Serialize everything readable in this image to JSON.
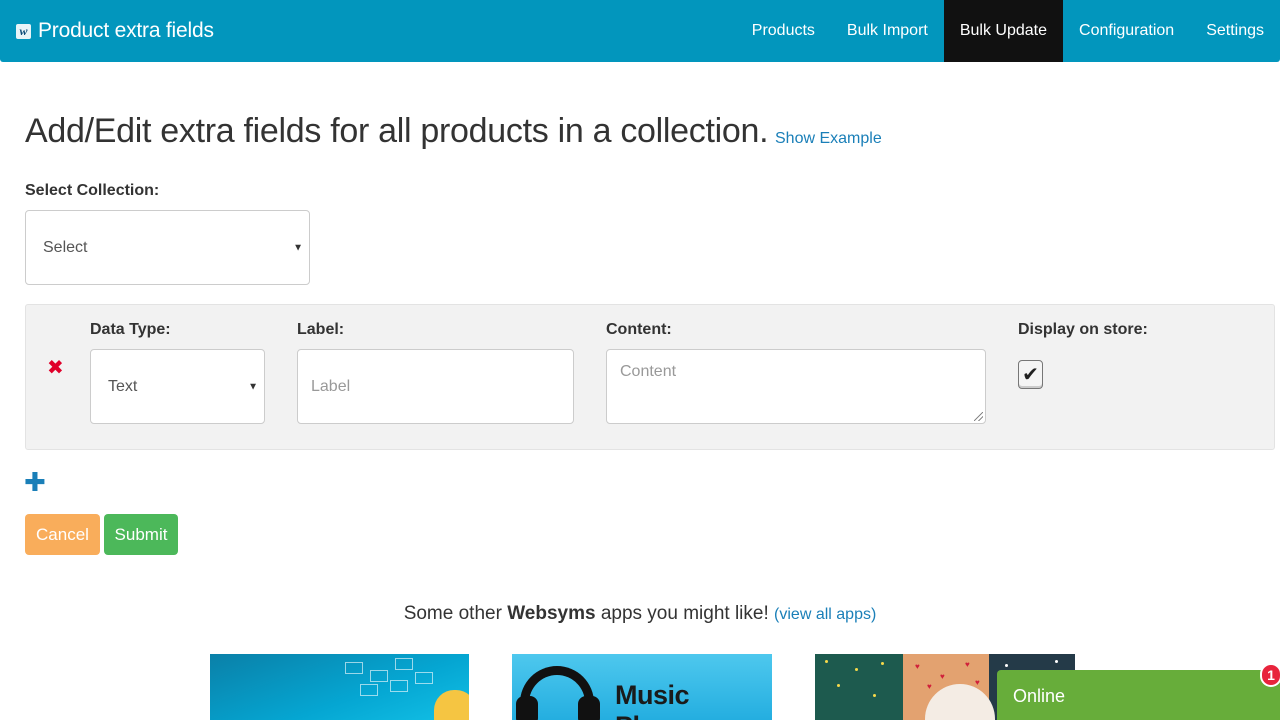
{
  "navbar": {
    "brand_logo": "w",
    "brand_title": "Product extra fields",
    "items": [
      {
        "label": "Products",
        "active": false
      },
      {
        "label": "Bulk Import",
        "active": false
      },
      {
        "label": "Bulk Update",
        "active": true
      },
      {
        "label": "Configuration",
        "active": false
      },
      {
        "label": "Settings",
        "active": false
      }
    ],
    "color": "#0296bd"
  },
  "main": {
    "title": "Add/Edit extra fields for all products in a collection.",
    "show_example": "Show Example",
    "collection_label": "Select Collection:",
    "collection_value": "Select"
  },
  "field_row": {
    "data_type_label": "Data Type:",
    "data_type_value": "Text",
    "label_label": "Label:",
    "label_placeholder": "Label",
    "content_label": "Content:",
    "content_placeholder": "Content",
    "display_label": "Display on store:",
    "display_checked": true,
    "remove_icon": "close-icon"
  },
  "actions": {
    "add_icon": "plus-icon",
    "cancel_label": "Cancel",
    "submit_label": "Submit",
    "cancel_color": "#f9ad5b",
    "submit_color": "#4cb85a"
  },
  "promo": {
    "prefix": "Some other ",
    "brand": "Websyms",
    "suffix": " apps you might like!",
    "link": "(view all apps)",
    "apps": [
      {
        "title": ""
      },
      {
        "title": "Music Player"
      },
      {
        "title": ""
      }
    ]
  },
  "chat": {
    "status": "Online",
    "badge_count": "1",
    "color": "#67ad3a"
  }
}
